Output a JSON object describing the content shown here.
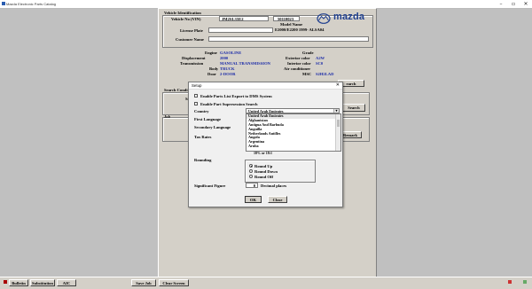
{
  "window": {
    "title": "Mazda Electronic Parts Catalog"
  },
  "vehicle_identification": {
    "header": "Vehicle Identification",
    "vin_label": "Vehicle No (VIN)",
    "vin_value": "JM2SL35E2",
    "vin_serial": "50110023",
    "model_name_label": "Model Name",
    "model_name_value": "E2000/E2200 1999- ALSA04",
    "license_plate_label": "License Plate",
    "customer_name_label": "Customer Name",
    "brand": "mazda"
  },
  "specs": {
    "engine_label": "Engine",
    "engine_value": "GASOLINE",
    "displacement_label": "Displacement",
    "displacement_value": "2000",
    "transmission_label": "Transmission",
    "transmission_value": "MANUAL TRANSMISSION",
    "body_label": "Body",
    "body_value": "TRUCK",
    "door_label": "Door",
    "door_value": "2-DOOR",
    "grade_label": "Grade",
    "exterior_color_label": "Exterior color",
    "exterior_color_value": "A2W",
    "interior_color_label": "Interior color",
    "interior_color_value": "SC0",
    "air_conditioner_label": "Air conditioner",
    "msc_label": "MSC",
    "msc_value": "S2H2LAD"
  },
  "background": {
    "search_label": "Search Condi",
    "search_button_1": "earch",
    "search_button_2": "Search",
    "job_label": "Job",
    "remark_button": "Remark"
  },
  "setup_dialog": {
    "title": "Setup",
    "close_glyph": "✕",
    "enable_export_label": "Enable Parts List Export to DMS System",
    "enable_supersession_label": "Enable Part Supersession Search",
    "country_label": "Country",
    "country_value": "United Arab Emirates",
    "country_options": [
      "United Arab Emirates",
      "Afghanistan",
      "Antigua And Barbuda",
      "Anguilla",
      "Netherlands Antilles",
      "Angola",
      "Argentina",
      "Aruba"
    ],
    "first_language_label": "First Language",
    "secondary_language_label": "Secondary Language",
    "tax_rates_label": "Tax Rates",
    "tax_rate_partial": "18% or 18:1",
    "rounding_label": "Rounding",
    "rounding_options": [
      "Round Up",
      "Round Down",
      "Round Off"
    ],
    "significant_figure_label": "Significant Figure",
    "significant_figure_value": "0",
    "decimal_places_label": "Decimal places",
    "ok_button": "OK",
    "close_button": "Close"
  },
  "footer": {
    "bulletin": "Bulletin",
    "substitution": "Substitution",
    "aic": "AIC",
    "save_job": "Save Job",
    "clear_screen": "Clear Screen"
  },
  "colors": {
    "value_blue": "#1a2aa8",
    "mazda_blue": "#1f3f8f"
  }
}
